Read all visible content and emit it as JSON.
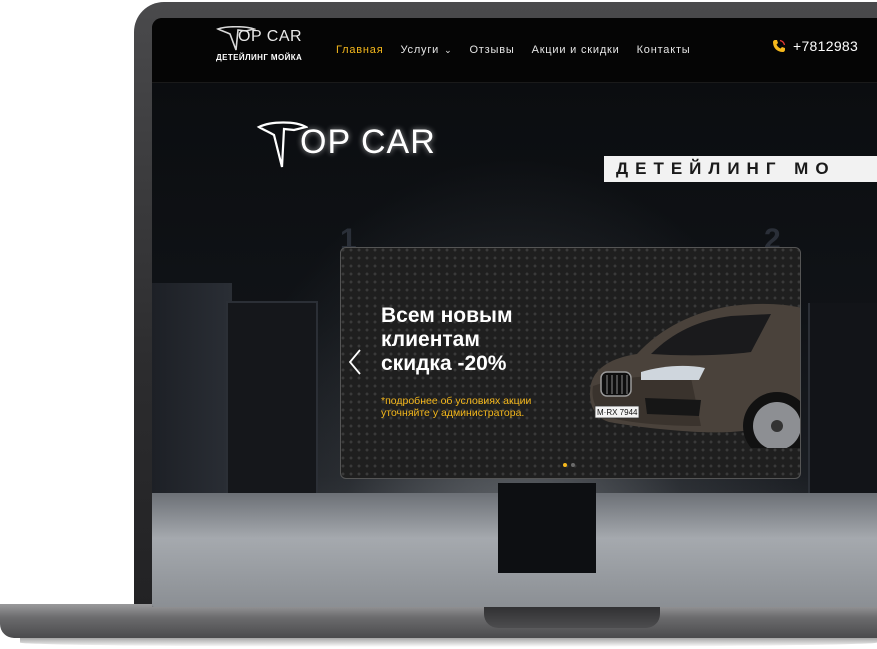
{
  "header": {
    "logo_text": "OP CAR",
    "logo_sub": "ДЕТЕЙЛИНГ МОЙКА",
    "nav": [
      {
        "label": "Главная",
        "active": true
      },
      {
        "label": "Услуги",
        "has_dropdown": true
      },
      {
        "label": "Отзывы"
      },
      {
        "label": "Акции и скидки"
      },
      {
        "label": "Контакты"
      }
    ],
    "phone": "+7812983"
  },
  "hero": {
    "brand_sign": "OP CAR",
    "sign_board": "ДЕТЕЙЛИНГ МО",
    "bay_numbers": [
      "1",
      "2"
    ]
  },
  "slider": {
    "title_line1": "Всем новым",
    "title_line2": "клиентам",
    "title_line3": "скидка -20%",
    "note_line1": "*подробнее об условиях акции",
    "note_line2": "уточняйте у администратора.",
    "plate": "M·RX 7944",
    "dots": 2,
    "active_dot": 0
  },
  "colors": {
    "accent": "#f5b81c",
    "header_bg": "#050505",
    "text": "#ffffff"
  },
  "icons": {
    "phone": "phone-icon",
    "prev": "chevron-left-icon",
    "dropdown": "chevron-down-icon"
  }
}
